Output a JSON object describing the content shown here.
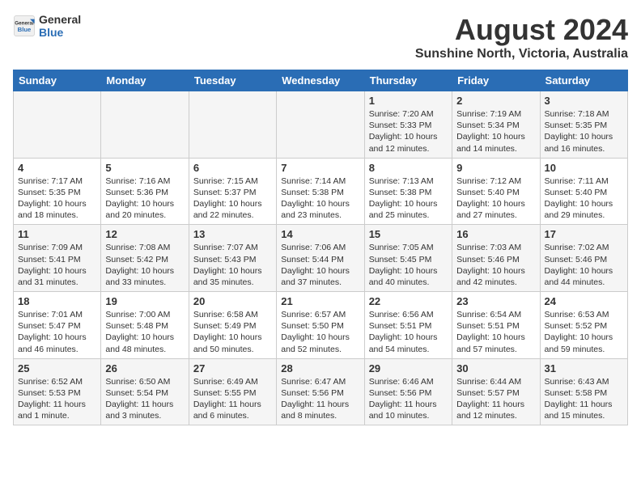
{
  "header": {
    "logo_line1": "General",
    "logo_line2": "Blue",
    "month": "August 2024",
    "location": "Sunshine North, Victoria, Australia"
  },
  "days_of_week": [
    "Sunday",
    "Monday",
    "Tuesday",
    "Wednesday",
    "Thursday",
    "Friday",
    "Saturday"
  ],
  "weeks": [
    [
      {
        "num": "",
        "detail": ""
      },
      {
        "num": "",
        "detail": ""
      },
      {
        "num": "",
        "detail": ""
      },
      {
        "num": "",
        "detail": ""
      },
      {
        "num": "1",
        "detail": "Sunrise: 7:20 AM\nSunset: 5:33 PM\nDaylight: 10 hours\nand 12 minutes."
      },
      {
        "num": "2",
        "detail": "Sunrise: 7:19 AM\nSunset: 5:34 PM\nDaylight: 10 hours\nand 14 minutes."
      },
      {
        "num": "3",
        "detail": "Sunrise: 7:18 AM\nSunset: 5:35 PM\nDaylight: 10 hours\nand 16 minutes."
      }
    ],
    [
      {
        "num": "4",
        "detail": "Sunrise: 7:17 AM\nSunset: 5:35 PM\nDaylight: 10 hours\nand 18 minutes."
      },
      {
        "num": "5",
        "detail": "Sunrise: 7:16 AM\nSunset: 5:36 PM\nDaylight: 10 hours\nand 20 minutes."
      },
      {
        "num": "6",
        "detail": "Sunrise: 7:15 AM\nSunset: 5:37 PM\nDaylight: 10 hours\nand 22 minutes."
      },
      {
        "num": "7",
        "detail": "Sunrise: 7:14 AM\nSunset: 5:38 PM\nDaylight: 10 hours\nand 23 minutes."
      },
      {
        "num": "8",
        "detail": "Sunrise: 7:13 AM\nSunset: 5:38 PM\nDaylight: 10 hours\nand 25 minutes."
      },
      {
        "num": "9",
        "detail": "Sunrise: 7:12 AM\nSunset: 5:40 PM\nDaylight: 10 hours\nand 27 minutes."
      },
      {
        "num": "10",
        "detail": "Sunrise: 7:11 AM\nSunset: 5:40 PM\nDaylight: 10 hours\nand 29 minutes."
      }
    ],
    [
      {
        "num": "11",
        "detail": "Sunrise: 7:09 AM\nSunset: 5:41 PM\nDaylight: 10 hours\nand 31 minutes."
      },
      {
        "num": "12",
        "detail": "Sunrise: 7:08 AM\nSunset: 5:42 PM\nDaylight: 10 hours\nand 33 minutes."
      },
      {
        "num": "13",
        "detail": "Sunrise: 7:07 AM\nSunset: 5:43 PM\nDaylight: 10 hours\nand 35 minutes."
      },
      {
        "num": "14",
        "detail": "Sunrise: 7:06 AM\nSunset: 5:44 PM\nDaylight: 10 hours\nand 37 minutes."
      },
      {
        "num": "15",
        "detail": "Sunrise: 7:05 AM\nSunset: 5:45 PM\nDaylight: 10 hours\nand 40 minutes."
      },
      {
        "num": "16",
        "detail": "Sunrise: 7:03 AM\nSunset: 5:46 PM\nDaylight: 10 hours\nand 42 minutes."
      },
      {
        "num": "17",
        "detail": "Sunrise: 7:02 AM\nSunset: 5:46 PM\nDaylight: 10 hours\nand 44 minutes."
      }
    ],
    [
      {
        "num": "18",
        "detail": "Sunrise: 7:01 AM\nSunset: 5:47 PM\nDaylight: 10 hours\nand 46 minutes."
      },
      {
        "num": "19",
        "detail": "Sunrise: 7:00 AM\nSunset: 5:48 PM\nDaylight: 10 hours\nand 48 minutes."
      },
      {
        "num": "20",
        "detail": "Sunrise: 6:58 AM\nSunset: 5:49 PM\nDaylight: 10 hours\nand 50 minutes."
      },
      {
        "num": "21",
        "detail": "Sunrise: 6:57 AM\nSunset: 5:50 PM\nDaylight: 10 hours\nand 52 minutes."
      },
      {
        "num": "22",
        "detail": "Sunrise: 6:56 AM\nSunset: 5:51 PM\nDaylight: 10 hours\nand 54 minutes."
      },
      {
        "num": "23",
        "detail": "Sunrise: 6:54 AM\nSunset: 5:51 PM\nDaylight: 10 hours\nand 57 minutes."
      },
      {
        "num": "24",
        "detail": "Sunrise: 6:53 AM\nSunset: 5:52 PM\nDaylight: 10 hours\nand 59 minutes."
      }
    ],
    [
      {
        "num": "25",
        "detail": "Sunrise: 6:52 AM\nSunset: 5:53 PM\nDaylight: 11 hours\nand 1 minute."
      },
      {
        "num": "26",
        "detail": "Sunrise: 6:50 AM\nSunset: 5:54 PM\nDaylight: 11 hours\nand 3 minutes."
      },
      {
        "num": "27",
        "detail": "Sunrise: 6:49 AM\nSunset: 5:55 PM\nDaylight: 11 hours\nand 6 minutes."
      },
      {
        "num": "28",
        "detail": "Sunrise: 6:47 AM\nSunset: 5:56 PM\nDaylight: 11 hours\nand 8 minutes."
      },
      {
        "num": "29",
        "detail": "Sunrise: 6:46 AM\nSunset: 5:56 PM\nDaylight: 11 hours\nand 10 minutes."
      },
      {
        "num": "30",
        "detail": "Sunrise: 6:44 AM\nSunset: 5:57 PM\nDaylight: 11 hours\nand 12 minutes."
      },
      {
        "num": "31",
        "detail": "Sunrise: 6:43 AM\nSunset: 5:58 PM\nDaylight: 11 hours\nand 15 minutes."
      }
    ]
  ]
}
